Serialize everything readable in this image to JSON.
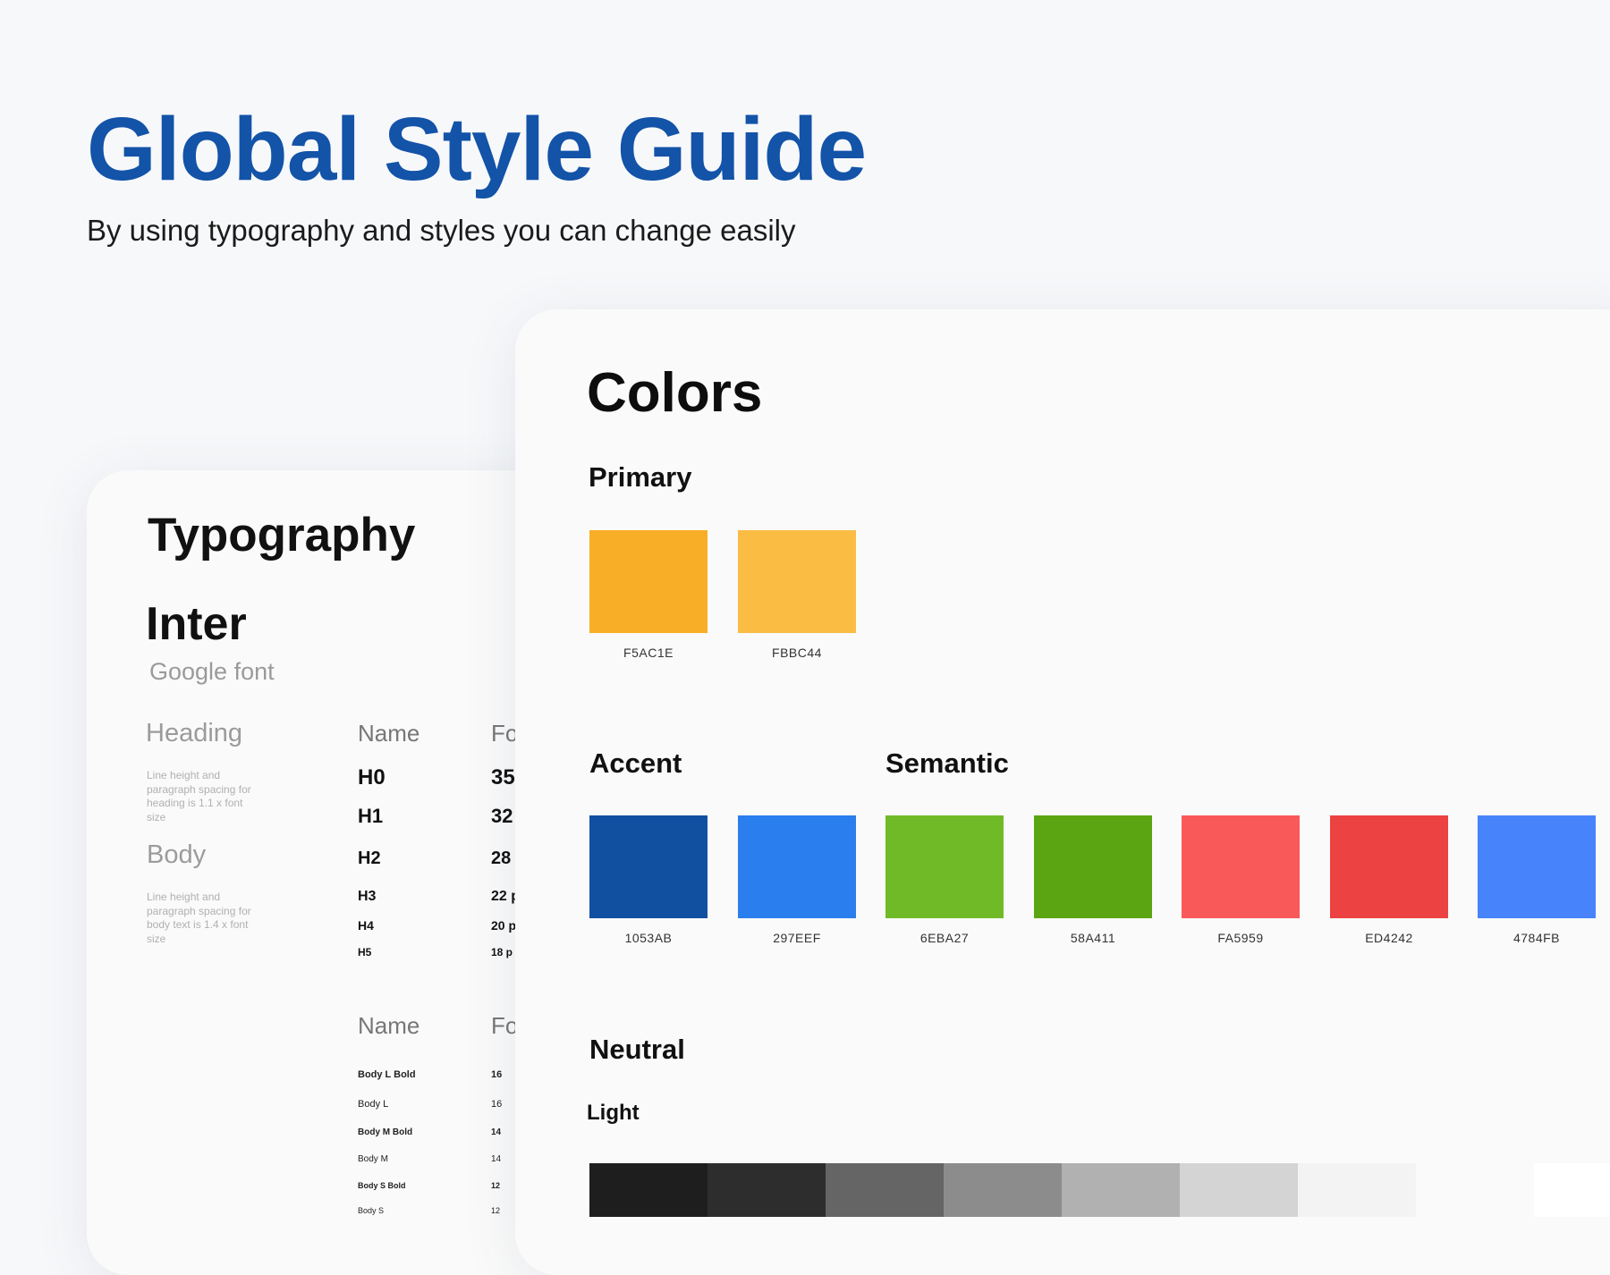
{
  "header": {
    "title": "Global Style Guide",
    "subtitle": "By using typography and styles you can change easily"
  },
  "typography": {
    "title": "Typography",
    "font_name": "Inter",
    "font_source": "Google font",
    "heading_section": {
      "label": "Heading",
      "note": "Line height and paragraph spacing for heading is 1.1 x font size"
    },
    "body_section": {
      "label": "Body",
      "note": "Line height and paragraph spacing for body text is 1.4 x font size"
    },
    "heading_table": {
      "col_name": "Name",
      "col_size": "Fo",
      "rows": [
        {
          "name": "H0",
          "size": "35"
        },
        {
          "name": "H1",
          "size": "32"
        },
        {
          "name": "H2",
          "size": "28"
        },
        {
          "name": "H3",
          "size": "22 p"
        },
        {
          "name": "H4",
          "size": "20 p"
        },
        {
          "name": "H5",
          "size": "18 p"
        }
      ]
    },
    "body_table": {
      "col_name": "Name",
      "col_size": "Fo",
      "rows": [
        {
          "name": "Body L Bold",
          "size": "16"
        },
        {
          "name": "Body L",
          "size": "16"
        },
        {
          "name": "Body M Bold",
          "size": "14"
        },
        {
          "name": "Body M",
          "size": "14"
        },
        {
          "name": "Body S Bold",
          "size": "12"
        },
        {
          "name": "Body S",
          "size": "12"
        }
      ]
    }
  },
  "colors": {
    "title": "Colors",
    "primary": {
      "label": "Primary",
      "swatches": [
        {
          "hex": "F5AC1E",
          "color": "#F9AE27"
        },
        {
          "hex": "FBBC44",
          "color": "#FBBC44"
        }
      ]
    },
    "accent": {
      "label": "Accent",
      "swatches": [
        {
          "hex": "1053AB",
          "color": "#1150A0"
        },
        {
          "hex": "297EEF",
          "color": "#2B7EEE"
        }
      ]
    },
    "semantic": {
      "label": "Semantic",
      "swatches": [
        {
          "hex": "6EBA27",
          "color": "#71BA27"
        },
        {
          "hex": "58A411",
          "color": "#5AA511"
        },
        {
          "hex": "FA5959",
          "color": "#FA5959"
        },
        {
          "hex": "ED4242",
          "color": "#ED4242"
        },
        {
          "hex": "4784FB",
          "color": "#4784FB"
        }
      ]
    },
    "neutral": {
      "label": "Neutral",
      "light_label": "Light",
      "swatches": [
        "#1E1E1E",
        "#2D2D2D",
        "#656565",
        "#8C8C8C",
        "#B1B1B1",
        "#D4D4D4",
        "#F3F3F3",
        "#FAFAFA",
        "#FFFFFF"
      ]
    }
  }
}
